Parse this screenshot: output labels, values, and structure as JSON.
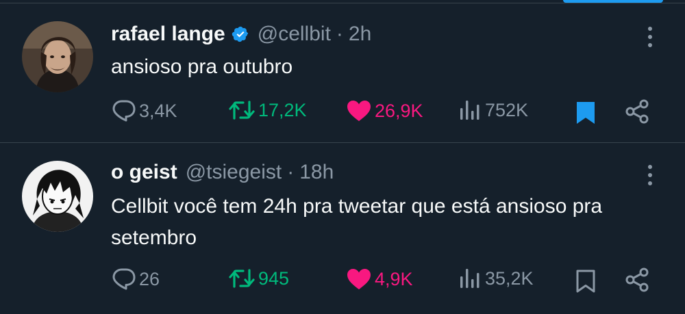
{
  "tweets": [
    {
      "author_name": "rafael lange",
      "verified": true,
      "handle": "@cellbit",
      "separator": "·",
      "time": "2h",
      "text": "ansioso pra outubro",
      "replies": "3,4K",
      "retweets": "17,2K",
      "likes": "26,9K",
      "views": "752K",
      "liked": true,
      "retweeted": true,
      "bookmarked": true
    },
    {
      "author_name": "o geist",
      "verified": false,
      "handle": "@tsiegeist",
      "separator": "·",
      "time": "18h",
      "text": "Cellbit você tem 24h pra tweetar que está ansioso pra setembro",
      "replies": "26",
      "retweets": "945",
      "likes": "4,9K",
      "views": "35,2K",
      "liked": true,
      "retweeted": true,
      "bookmarked": false
    }
  ],
  "colors": {
    "background": "#15202b",
    "text": "#f7f9f9",
    "muted": "#8b98a5",
    "retweet": "#00ba7c",
    "like": "#f91880",
    "accent": "#1d9bf0"
  },
  "icons": [
    "verified-badge-icon",
    "more-options-icon",
    "reply-icon",
    "retweet-icon",
    "like-icon",
    "views-icon",
    "bookmark-icon",
    "share-icon"
  ]
}
